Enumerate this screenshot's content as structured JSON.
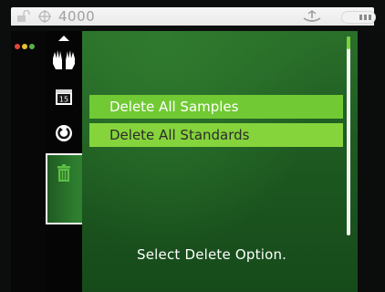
{
  "statusbar": {
    "model_number": "4000",
    "icons": [
      "lock-icon",
      "crosshair-icon",
      "antenna-icon",
      "battery-icon"
    ]
  },
  "iconstrip": {
    "dots_colors": [
      "#e0463b",
      "#e8c12e",
      "#58b24a"
    ]
  },
  "toolbar": {
    "icons": [
      "up-arrow-icon",
      "hands-icon",
      "calendar-icon",
      "circle-arrow-icon",
      "trash-icon"
    ],
    "calendar_number": "15",
    "selected_icon": "trash-icon"
  },
  "menu": {
    "items": [
      {
        "label": "Delete All Samples",
        "selected": true
      },
      {
        "label": "Delete All Standards",
        "selected": false
      }
    ]
  },
  "prompt": "Select Delete Option.",
  "colors": {
    "panel_green": "#1e5a21",
    "highlight_green": "#71c934",
    "item_green": "#86d43c"
  }
}
